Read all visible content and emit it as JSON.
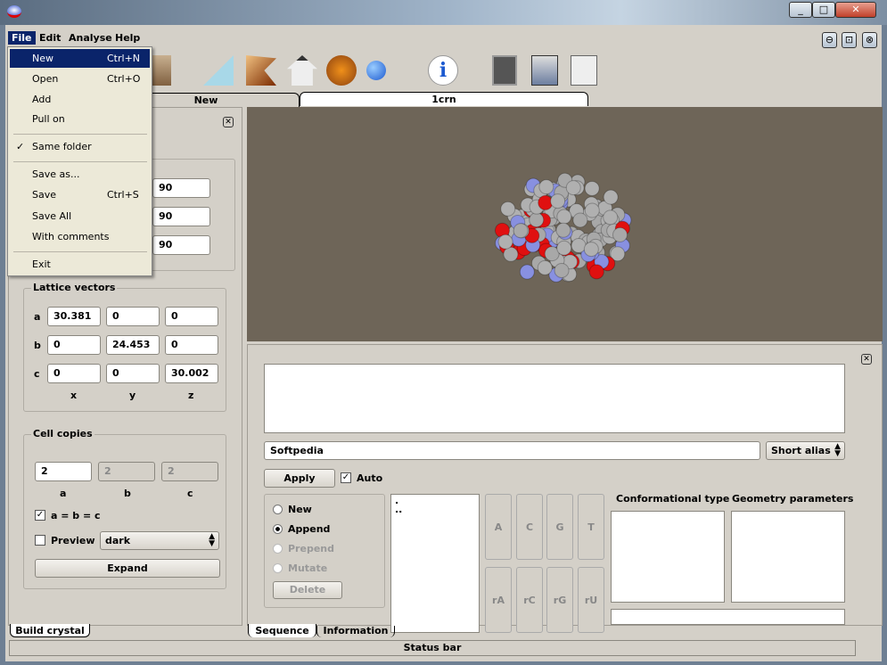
{
  "window": {
    "controls": [
      "_",
      "□",
      "✕"
    ],
    "inner_controls": [
      "⊖",
      "⊡",
      "⊗"
    ]
  },
  "menubar": [
    "File",
    "Edit",
    "Analyse",
    "Help"
  ],
  "file_menu": [
    {
      "label": "New",
      "shortcut": "Ctrl+N"
    },
    {
      "label": "Open",
      "shortcut": "Ctrl+O"
    },
    {
      "label": "Add",
      "shortcut": ""
    },
    {
      "label": "Pull on",
      "shortcut": ""
    },
    {
      "label": "Same folder",
      "shortcut": "",
      "checked": true
    },
    {
      "label": "Save as...",
      "shortcut": ""
    },
    {
      "label": "Save",
      "shortcut": "Ctrl+S"
    },
    {
      "label": "Save All",
      "shortcut": ""
    },
    {
      "label": "With comments",
      "shortcut": ""
    },
    {
      "label": "Exit",
      "shortcut": ""
    }
  ],
  "tabs": {
    "doc": [
      "New",
      "1crn"
    ],
    "left_bottom": "Build crystal",
    "bottom": [
      "Sequence",
      "Information"
    ]
  },
  "angles": [
    "90",
    "90",
    "90"
  ],
  "lattice": {
    "title": "Lattice vectors",
    "rows": [
      {
        "label": "a",
        "values": [
          "30.381",
          "0",
          "0"
        ]
      },
      {
        "label": "b",
        "values": [
          "0",
          "24.453",
          "0"
        ]
      },
      {
        "label": "c",
        "values": [
          "0",
          "0",
          "30.002"
        ]
      }
    ],
    "axes": [
      "x",
      "y",
      "z"
    ]
  },
  "cell": {
    "title": "Cell copies",
    "values": [
      "2",
      "2",
      "2"
    ],
    "labels": [
      "a",
      "b",
      "c"
    ],
    "equal_label": "a = b = c",
    "preview_label": "Preview",
    "preview_style": "dark",
    "expand": "Expand"
  },
  "sequence": {
    "name": "Softpedia",
    "alias": "Short alias",
    "apply": "Apply",
    "auto": "Auto",
    "modes": [
      "New",
      "Append",
      "Prepend",
      "Mutate"
    ],
    "delete": "Delete",
    "list": [
      ".",
      ".."
    ],
    "nucleotides": [
      "A",
      "C",
      "G",
      "T",
      "rA",
      "rC",
      "rG",
      "rU"
    ],
    "conf_type": "Conformational type",
    "geom_params": "Geometry parameters"
  },
  "status": "Status bar"
}
